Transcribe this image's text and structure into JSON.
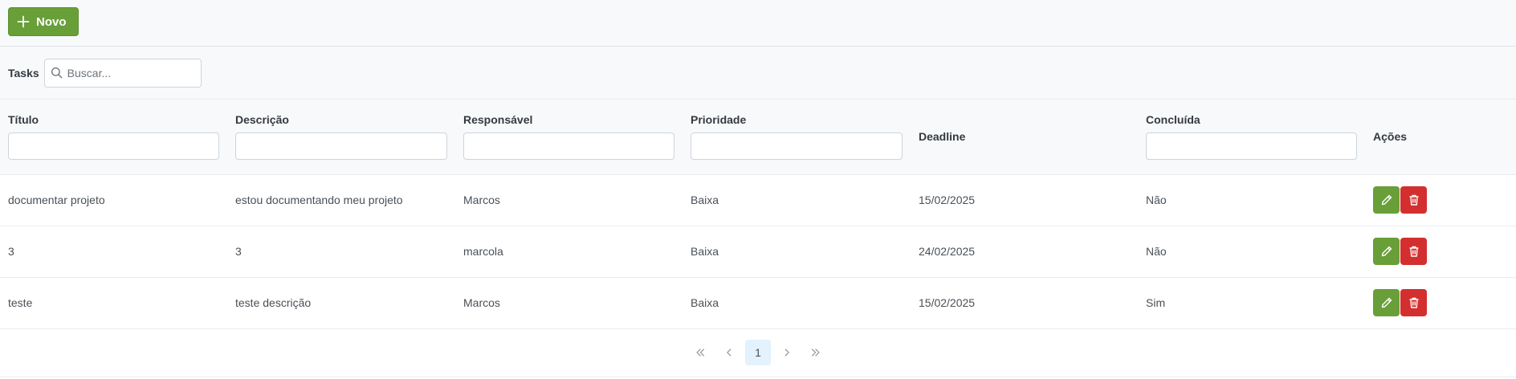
{
  "toolbar": {
    "new_label": "Novo"
  },
  "header": {
    "title": "Tasks",
    "search_placeholder": "Buscar..."
  },
  "columns": [
    "Título",
    "Descrição",
    "Responsável",
    "Prioridade",
    "Deadline",
    "Concluída",
    "Ações"
  ],
  "rows": [
    {
      "titulo": "documentar projeto",
      "descricao": "estou documentando meu projeto",
      "responsavel": "Marcos",
      "prioridade": "Baixa",
      "deadline": "15/02/2025",
      "concluida": "Não"
    },
    {
      "titulo": "3",
      "descricao": "3",
      "responsavel": "marcola",
      "prioridade": "Baixa",
      "deadline": "24/02/2025",
      "concluida": "Não"
    },
    {
      "titulo": "teste",
      "descricao": "teste descrição",
      "responsavel": "Marcos",
      "prioridade": "Baixa",
      "deadline": "15/02/2025",
      "concluida": "Sim"
    }
  ],
  "pagination": {
    "current_page": "1"
  },
  "colors": {
    "primary_green": "#689f38",
    "danger_red": "#d32f2f",
    "active_page_bg": "#e3f2fd"
  }
}
